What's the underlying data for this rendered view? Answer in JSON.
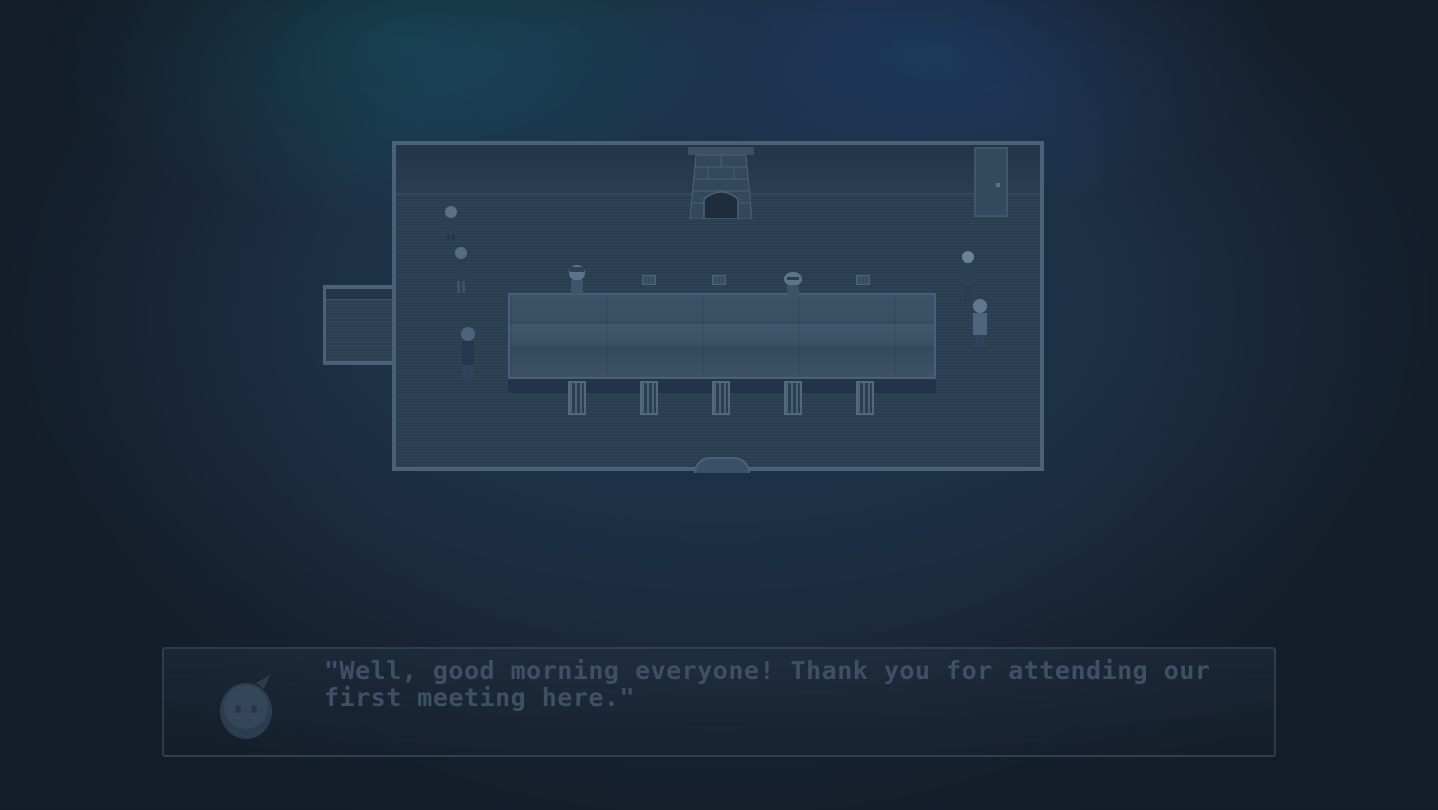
{
  "dialog": {
    "line1": "\"Well, good morning everyone! Thank you for attending our",
    "line2": "first meeting here.\""
  },
  "colors": {
    "background": "#1b2737",
    "room_border": "#4a6276",
    "floor": "#2a3e52",
    "dialog_text": "#3d5064"
  },
  "icons": {
    "portrait": "speaker-portrait"
  }
}
